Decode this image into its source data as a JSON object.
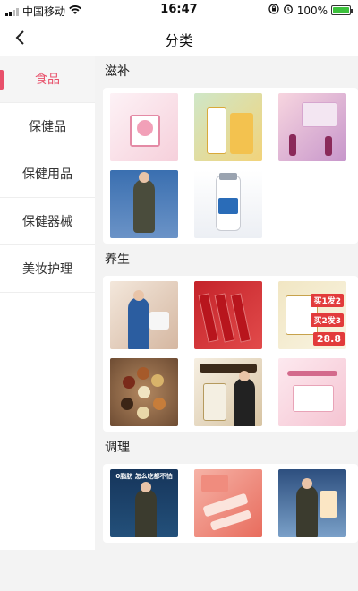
{
  "status_bar": {
    "carrier": "中国移动",
    "time": "16:47",
    "battery": "100%",
    "battery_level": 1.0
  },
  "nav": {
    "title": "分类"
  },
  "sidebar": {
    "items": [
      {
        "label": "食品",
        "active": true
      },
      {
        "label": "保健品",
        "active": false
      },
      {
        "label": "保健用品",
        "active": false
      },
      {
        "label": "保健器械",
        "active": false
      },
      {
        "label": "美妆护理",
        "active": false
      }
    ]
  },
  "sections": [
    {
      "title": "滋补",
      "products": 5
    },
    {
      "title": "养生",
      "products": 6
    },
    {
      "title": "调理",
      "products": 3
    }
  ],
  "images": {
    "yangsheng_price": "28.8",
    "yangsheng_promo1": "买1发2",
    "yangsheng_promo2": "买2发3",
    "tiaoli_banner": "0脂肪 怎么吃都不怕"
  },
  "colors": {
    "accent": "#e8506a"
  },
  "icons": {
    "back": "chevron-left-icon",
    "wifi": "wifi-icon",
    "lock": "orientation-lock-icon",
    "alarm": "alarm-icon"
  }
}
